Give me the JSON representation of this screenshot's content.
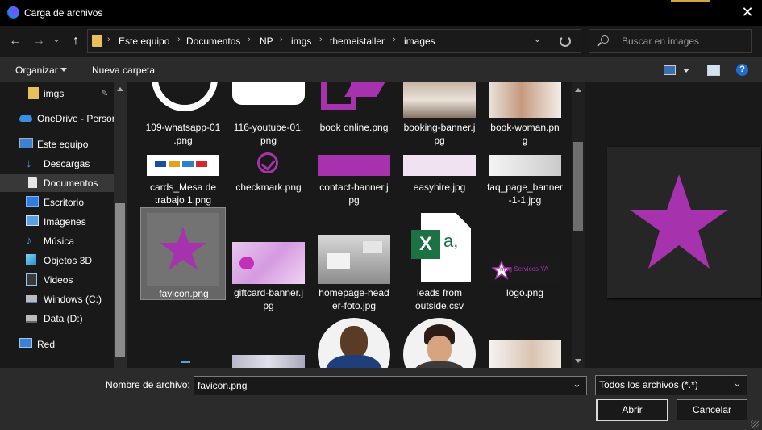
{
  "window": {
    "title": "Carga de archivos",
    "close_glyph": "✕"
  },
  "nav": {
    "back": "←",
    "forward": "→",
    "dropdown": "⌄",
    "up": "↑"
  },
  "address": {
    "crumbs": [
      "Este equipo",
      "Documentos",
      "NP",
      "imgs",
      "themeistaller",
      "images"
    ],
    "separator": "›"
  },
  "search": {
    "placeholder": "Buscar en images"
  },
  "toolbar": {
    "organize": "Organizar",
    "new_folder": "Nueva carpeta"
  },
  "sidebar": {
    "items": [
      {
        "label": "imgs",
        "icon": "folder-icon"
      },
      {
        "label": "OneDrive - Persor",
        "icon": "cloud-icon"
      },
      {
        "label": "Este equipo",
        "icon": "computer-icon"
      },
      {
        "label": "Descargas",
        "icon": "download-icon"
      },
      {
        "label": "Documentos",
        "icon": "document-icon"
      },
      {
        "label": "Escritorio",
        "icon": "desktop-icon"
      },
      {
        "label": "Imágenes",
        "icon": "pictures-icon"
      },
      {
        "label": "Música",
        "icon": "music-icon"
      },
      {
        "label": "Objetos 3D",
        "icon": "cube-icon"
      },
      {
        "label": "Videos",
        "icon": "video-icon"
      },
      {
        "label": "Windows (C:)",
        "icon": "drive-icon"
      },
      {
        "label": "Data (D:)",
        "icon": "drive-icon"
      },
      {
        "label": "Red",
        "icon": "network-icon"
      }
    ]
  },
  "files": [
    {
      "line1": "109-whatsapp-01",
      "line2": ".png"
    },
    {
      "line1": "116-youtube-01.",
      "line2": "png"
    },
    {
      "line1": "book online.png",
      "line2": ""
    },
    {
      "line1": "booking-banner.j",
      "line2": "pg"
    },
    {
      "line1": "book-woman.pn",
      "line2": "g"
    },
    {
      "line1": "cards_Mesa de",
      "line2": "trabajo 1.png"
    },
    {
      "line1": "checkmark.png",
      "line2": ""
    },
    {
      "line1": "contact-banner.j",
      "line2": "pg"
    },
    {
      "line1": "easyhire.jpg",
      "line2": ""
    },
    {
      "line1": "faq_page_banner",
      "line2": "-1-1.jpg"
    },
    {
      "line1": "favicon.png",
      "line2": ""
    },
    {
      "line1": "giftcard-banner.j",
      "line2": "pg"
    },
    {
      "line1": "homepage-head",
      "line2": "er-foto.jpg"
    },
    {
      "line1": "leads from",
      "line2": "outside.csv"
    },
    {
      "line1": "logo.png",
      "line2": ""
    }
  ],
  "thumb_text": {
    "logo": "ning Services YA"
  },
  "excel_icon": {
    "letter": "X",
    "subletter": "a,"
  },
  "bottom": {
    "filename_label": "Nombre de archivo:",
    "filename_value": "favicon.png",
    "filter_value": "Todos los archivos (*.*)",
    "open": "Abrir",
    "cancel": "Cancelar"
  },
  "colors": {
    "accent": "#a633ad",
    "titlebar": "#000000",
    "selected": "#666666",
    "excel": "#1d7244"
  }
}
